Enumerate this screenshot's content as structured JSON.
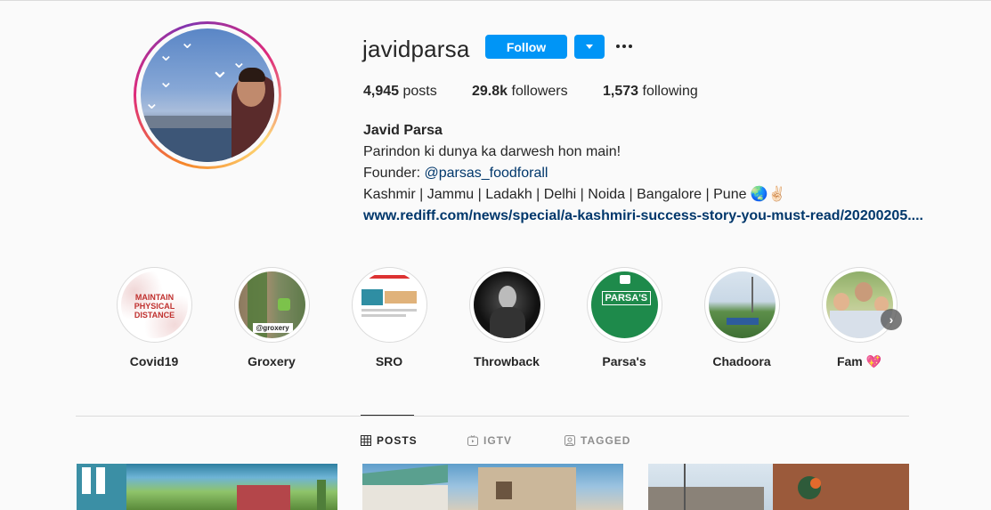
{
  "profile": {
    "username": "javidparsa",
    "follow_label": "Follow",
    "stats": {
      "posts_count": "4,945",
      "posts_label": "posts",
      "followers_count": "29.8k",
      "followers_label": "followers",
      "following_count": "1,573",
      "following_label": "following"
    },
    "bio": {
      "name": "Javid Parsa",
      "line1": "Parindon ki dunya ka darwesh hon main!",
      "founder_prefix": "Founder: ",
      "founder_mention": "@parsas_foodforall",
      "line3": "Kashmir | Jammu | Ladakh | Delhi | Noida | Bangalore | Pune 🌏✌🏻",
      "website": "www.rediff.com/news/special/a-kashmiri-success-story-you-must-read/20200205...."
    }
  },
  "highlights": [
    {
      "label": "Covid19",
      "cover_text": "MAINTAIN PHYSICAL DISTANCE"
    },
    {
      "label": "Groxery",
      "cover_text": "@groxery"
    },
    {
      "label": "SRO",
      "cover_text": ""
    },
    {
      "label": "Throwback",
      "cover_text": ""
    },
    {
      "label": "Parsa's",
      "cover_text": "PARSA'S"
    },
    {
      "label": "Chadoora",
      "cover_text": ""
    },
    {
      "label": "Fam 💖",
      "cover_text": ""
    }
  ],
  "tabs": [
    {
      "label": "POSTS",
      "icon": "grid-icon",
      "active": true
    },
    {
      "label": "IGTV",
      "icon": "igtv-icon",
      "active": false
    },
    {
      "label": "TAGGED",
      "icon": "tagged-icon",
      "active": false
    }
  ],
  "colors": {
    "accent": "#0095f6",
    "link": "#00376b",
    "background": "#fafafa"
  }
}
